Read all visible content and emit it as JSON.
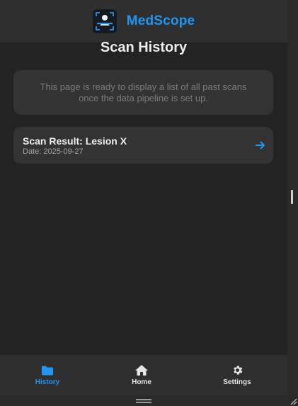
{
  "header": {
    "brand": "MedScope",
    "logo_icon": "scanner-person-icon"
  },
  "page": {
    "title": "Scan History",
    "notice": "This page is ready to display a list of all past scans once the data pipeline is set up."
  },
  "scans": [
    {
      "title": "Scan Result: Lesion X",
      "date": "Date: 2025-09-27",
      "icon": "arrow-right-icon"
    }
  ],
  "nav": {
    "history": "History",
    "home": "Home",
    "settings": "Settings"
  },
  "colors": {
    "accent": "#2196f3",
    "background": "#232323",
    "surface": "#333333",
    "bar": "#2f2f2f"
  }
}
